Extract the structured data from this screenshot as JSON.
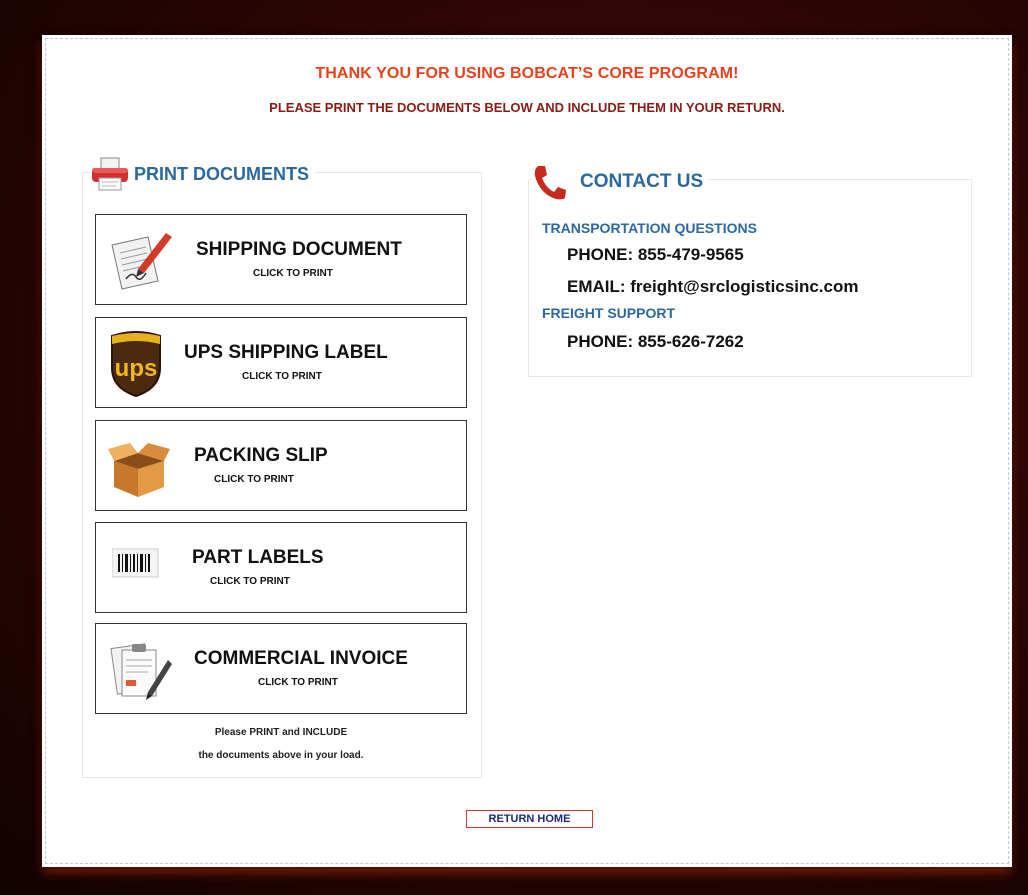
{
  "header": {
    "title": "THANK YOU FOR USING BOBCAT’S CORE PROGRAM!",
    "subtitle": "PLEASE PRINT THE DOCUMENTS BELOW AND INCLUDE THEM IN YOUR RETURN."
  },
  "print_panel": {
    "legend": "PRINT DOCUMENTS",
    "documents": [
      {
        "label": "SHIPPING DOCUMENT",
        "action": "CLICK TO PRINT",
        "icon": "signed-document-icon"
      },
      {
        "label": "UPS SHIPPING LABEL",
        "action": "CLICK TO PRINT",
        "icon": "ups-shield-icon"
      },
      {
        "label": "PACKING SLIP",
        "action": "CLICK TO PRINT",
        "icon": "cardboard-box-icon"
      },
      {
        "label": "PART LABELS",
        "action": "CLICK TO PRINT",
        "icon": "barcode-label-icon"
      },
      {
        "label": "COMMERCIAL INVOICE",
        "action": "CLICK TO PRINT",
        "icon": "invoice-pen-icon"
      }
    ],
    "footnote_line1": "Please PRINT and INCLUDE",
    "footnote_line2": "the documents above in your load."
  },
  "contact_panel": {
    "legend": "CONTACT US",
    "transport_heading": "TRANSPORTATION QUESTIONS",
    "transport_phone": "PHONE: 855-479-9565",
    "transport_email": "EMAIL: freight@srclogisticsinc.com",
    "freight_heading": "FREIGHT SUPPORT",
    "freight_phone": "PHONE: 855-626-7262"
  },
  "return_button": "RETURN HOME",
  "colors": {
    "title": "#e8421c",
    "subtitle": "#8a1c16",
    "legend": "#2c68a0",
    "backdrop": "#2a0604",
    "return_border": "#e03030"
  }
}
